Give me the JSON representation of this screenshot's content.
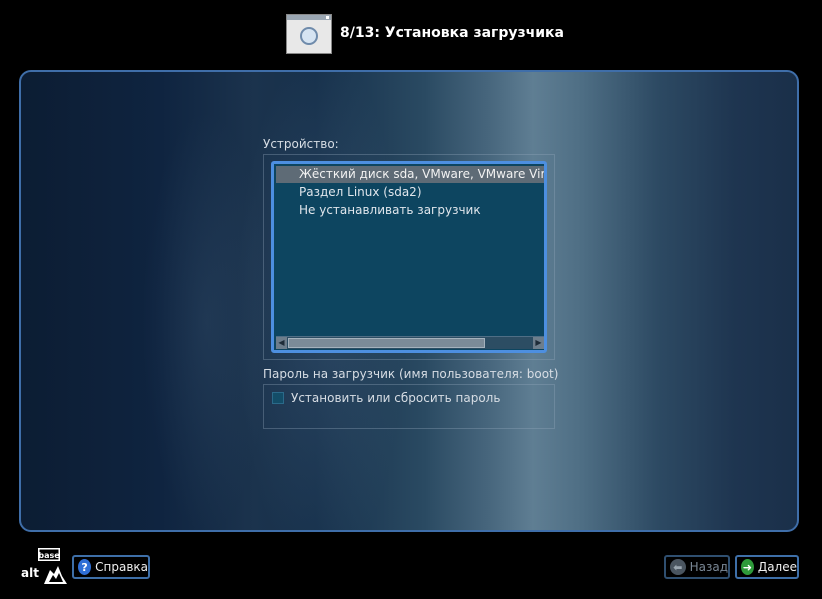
{
  "header": {
    "title": "8/13: Установка загрузчика",
    "icon": "window-icon"
  },
  "device": {
    "label": "Устройство:",
    "items": [
      {
        "text": "Жёсткий диск sda, VMware, VMware Virtual S",
        "selected": true
      },
      {
        "text": "Раздел Linux (sda2)",
        "selected": false
      },
      {
        "text": "Не устанавливать загрузчик",
        "selected": false
      }
    ]
  },
  "password": {
    "label": "Пароль на загрузчик (имя пользователя: boot)",
    "checkbox_label": "Установить или сбросить пароль",
    "checked": false
  },
  "footer": {
    "logo_top": "base",
    "logo_bottom": "alt",
    "help_label": "Справка",
    "back_label": "Назад",
    "next_label": "Далее"
  },
  "colors": {
    "accent_border": "#3f6ea9",
    "list_bg": "#0d4560",
    "selection": "#5e6b76",
    "next_icon": "#2e9a3a",
    "help_icon": "#2f6fd6"
  }
}
